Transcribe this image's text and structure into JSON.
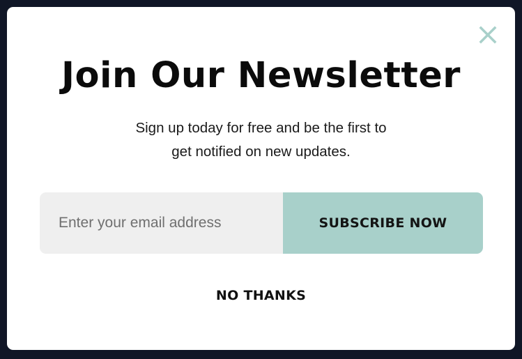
{
  "modal": {
    "title": "Join Our Newsletter",
    "subtitle_line1": "Sign up today for free and be the first to",
    "subtitle_line2": "get notified on new updates.",
    "email_placeholder": "Enter your email address",
    "email_value": "",
    "subscribe_label": "SUBSCRIBE NOW",
    "no_thanks_label": "NO THANKS",
    "close_icon": "close-icon"
  },
  "colors": {
    "background": "#101626",
    "modal": "#ffffff",
    "close_icon": "#a8d0ca",
    "input_bg": "#efefef",
    "button": "#a8d0ca"
  }
}
